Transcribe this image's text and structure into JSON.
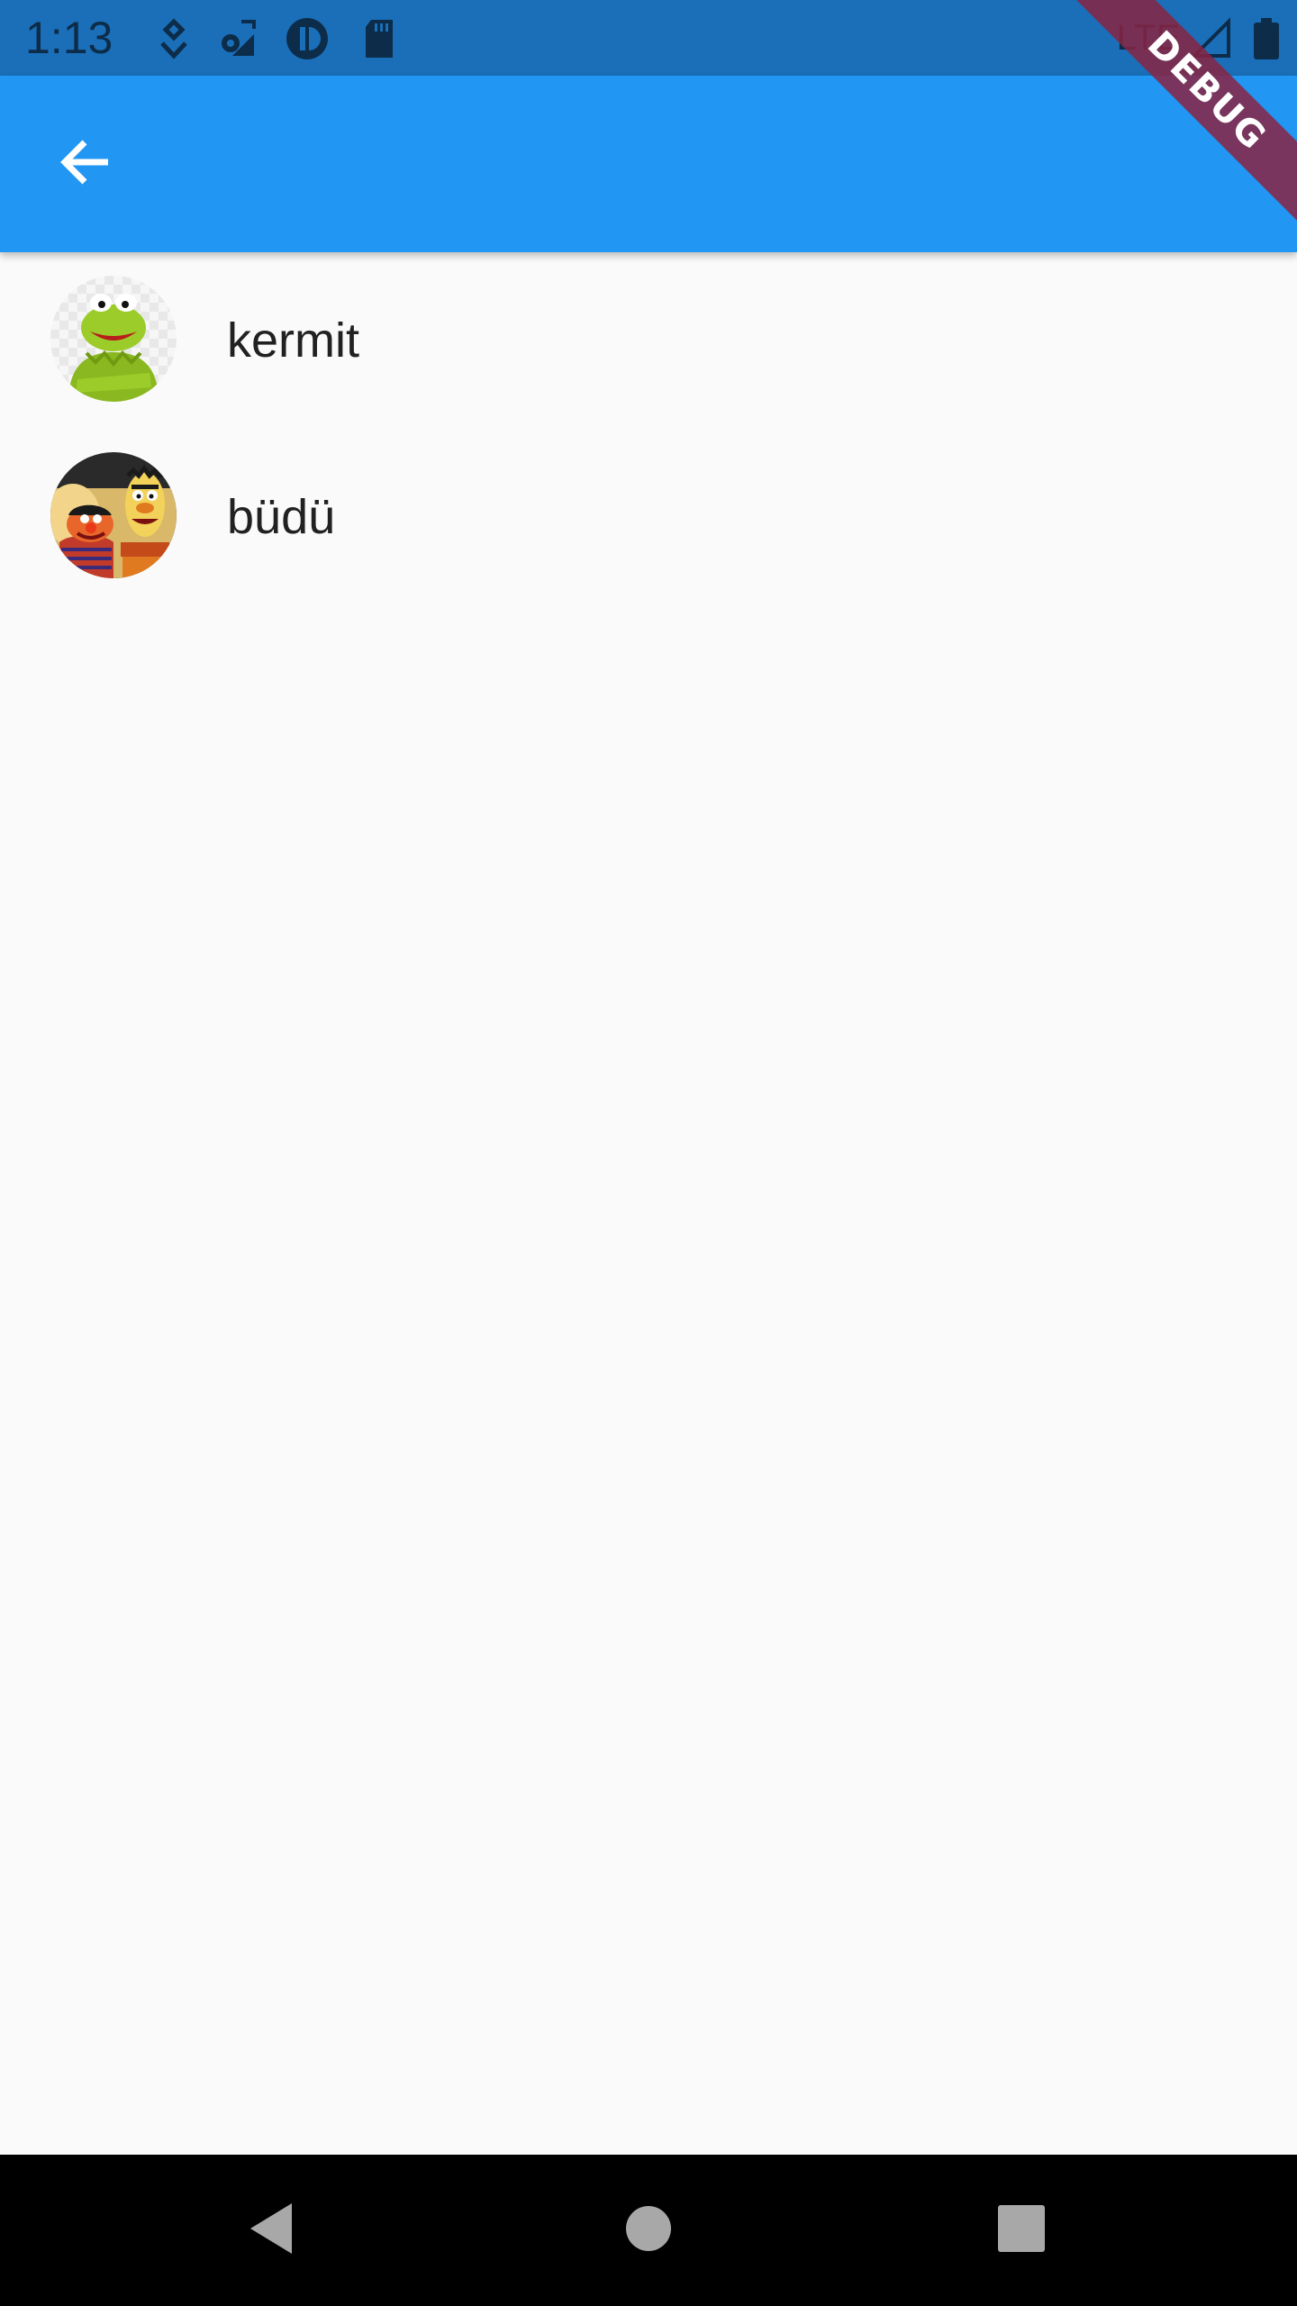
{
  "status_bar": {
    "time": "1:13",
    "network": "LTE",
    "icons": [
      "location-icon",
      "settings-sync-icon",
      "app-icon",
      "sd-card-icon",
      "signal-icon",
      "battery-icon"
    ],
    "color": "#1a6fb8"
  },
  "app_bar": {
    "back_icon": "arrow-back-icon",
    "color": "#2196f3"
  },
  "debug_banner": {
    "label": "DEBUG",
    "color": "#882442"
  },
  "contacts": [
    {
      "name": "kermit",
      "avatar": "kermit-avatar"
    },
    {
      "name": "büdü",
      "avatar": "bert-ernie-avatar"
    }
  ],
  "nav_bar": {
    "buttons": [
      "back-triangle-icon",
      "home-circle-icon",
      "recents-square-icon"
    ]
  }
}
